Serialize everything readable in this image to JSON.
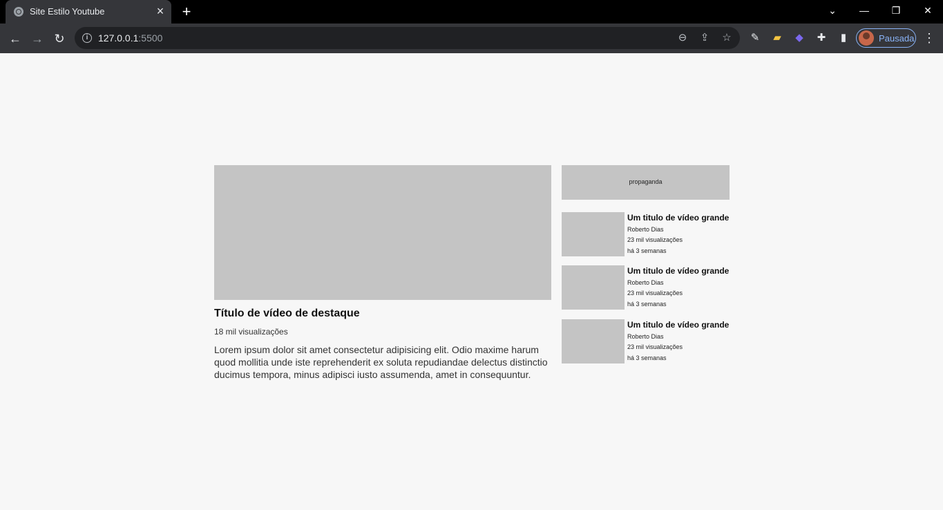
{
  "browser": {
    "tab_title": "Site Estilo Youtube",
    "url_host": "127.0.0.1",
    "url_port": ":5500",
    "profile_label": "Pausada"
  },
  "featured": {
    "title": "Título de vídeo de destaque",
    "views": "18 mil visualizações",
    "description": "Lorem ipsum dolor sit amet consectetur adipisicing elit. Odio maxime harum quod mollitia unde iste reprehenderit ex soluta repudiandae delectus distinctio ducimus tempora, minus adipisci iusto assumenda, amet in consequuntur."
  },
  "sidebar": {
    "ad_label": "propaganda",
    "videos": [
      {
        "title": "Um titulo de vídeo grande",
        "channel": "Roberto Dias",
        "views": "23 mil visualizações",
        "age": "há 3 semanas"
      },
      {
        "title": "Um titulo de vídeo grande",
        "channel": "Roberto Dias",
        "views": "23 mil visualizações",
        "age": "há 3 semanas"
      },
      {
        "title": "Um titulo de vídeo grande",
        "channel": "Roberto Dias",
        "views": "23 mil visualizações",
        "age": "há 3 semanas"
      }
    ]
  },
  "colors": {
    "page_background": "#f7f7f7",
    "placeholder_gray": "#c4c4c4",
    "chrome_dark": "#35363a",
    "profile_accent": "#8ab4f8"
  }
}
